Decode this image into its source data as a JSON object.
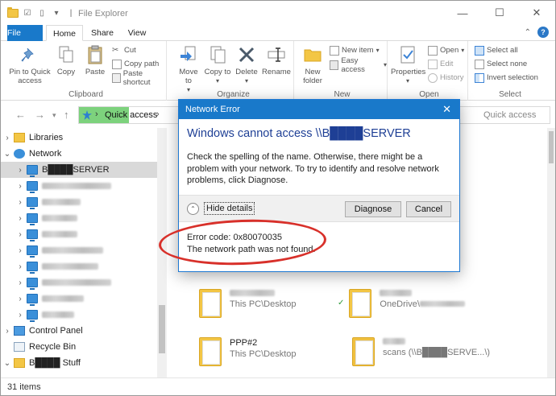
{
  "window": {
    "title": "File Explorer",
    "controls": [
      "—",
      "☐",
      "✕"
    ]
  },
  "ribbon_tabs": [
    "File",
    "Home",
    "Share",
    "View"
  ],
  "ribbon": {
    "clipboard": {
      "label": "Clipboard",
      "pin": "Pin to Quick access",
      "copy": "Copy",
      "paste": "Paste",
      "cut": "Cut",
      "copy_path": "Copy path",
      "paste_shortcut": "Paste shortcut"
    },
    "organize": {
      "label": "Organize",
      "move_to": "Move to",
      "copy_to": "Copy to",
      "delete": "Delete",
      "rename": "Rename"
    },
    "new": {
      "label": "New",
      "new_folder": "New folder",
      "new_item": "New item",
      "easy_access": "Easy access"
    },
    "open": {
      "label": "Open",
      "properties": "Properties",
      "open": "Open",
      "edit": "Edit",
      "history": "History"
    },
    "select": {
      "label": "Select",
      "select_all": "Select all",
      "select_none": "Select none",
      "invert_selection": "Invert selection"
    }
  },
  "address": {
    "location": "Quick access",
    "search_placeholder": "Quick access"
  },
  "nav_pane": {
    "libraries": "Libraries",
    "network": "Network",
    "server": "B████SERVER",
    "control_panel": "Control Panel",
    "recycle_bin": "Recycle Bin",
    "stuff": "B████ Stuff"
  },
  "content": {
    "files": [
      {
        "name": "",
        "location": "This PC\\Desktop"
      },
      {
        "name": "",
        "location": "OneDrive\\"
      },
      {
        "name": "PPP#2",
        "location": "This PC\\Desktop"
      },
      {
        "name": "",
        "location": "scans (\\\\B████SERVE...\\)"
      }
    ]
  },
  "status": {
    "count": "31 items"
  },
  "dialog": {
    "title": "Network Error",
    "heading": "Windows cannot access \\\\B████SERVER",
    "message": "Check the spelling of the name. Otherwise, there might be a problem with your network. To try to identify and resolve network problems, click Diagnose.",
    "hide_details": "Hide details",
    "diagnose": "Diagnose",
    "cancel": "Cancel",
    "error_code": "Error code: 0x80070035",
    "error_text": "The network path was not found."
  },
  "colors": {
    "accent": "#1979ca",
    "highlight_green": "#7dd27d",
    "annotation_red": "#d8302a",
    "heading_blue": "#1e3f95"
  }
}
